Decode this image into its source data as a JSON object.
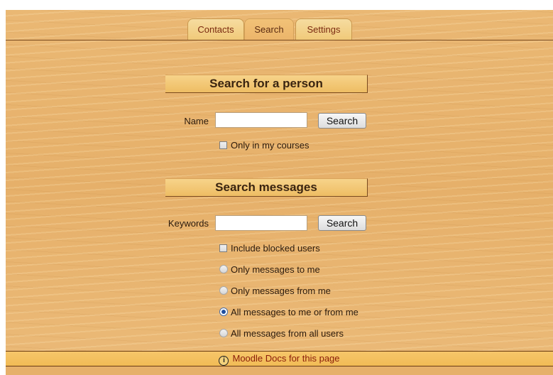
{
  "tabs": [
    {
      "label": "Contacts",
      "active": false
    },
    {
      "label": "Search",
      "active": true
    },
    {
      "label": "Settings",
      "active": false
    }
  ],
  "person_search": {
    "heading": "Search for a person",
    "name_label": "Name",
    "name_value": "",
    "button_label": "Search",
    "only_my_courses_label": "Only in my courses",
    "only_my_courses_checked": false
  },
  "message_search": {
    "heading": "Search messages",
    "keywords_label": "Keywords",
    "keywords_value": "",
    "button_label": "Search",
    "include_blocked_label": "Include blocked users",
    "include_blocked_checked": false,
    "options": [
      {
        "label": "Only messages to me",
        "selected": false
      },
      {
        "label": "Only messages from me",
        "selected": false
      },
      {
        "label": "All messages to me or from me",
        "selected": true
      },
      {
        "label": "All messages from all users",
        "selected": false
      }
    ]
  },
  "footer": {
    "icon": "info-icon",
    "link_label": "Moodle Docs for this page"
  },
  "colors": {
    "background": "#e9b56f",
    "tab_text": "#7a2a10",
    "footer_link": "#8a1c0a"
  }
}
